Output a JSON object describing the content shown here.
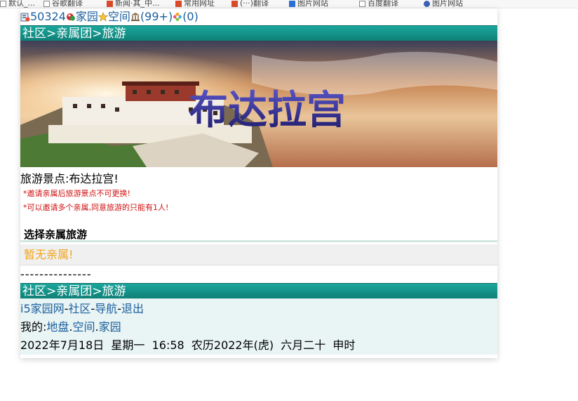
{
  "browser": {
    "bookmarks": [
      "默认_...",
      "谷歌翻译",
      "新闻·其_中...",
      "常用网址",
      "(···)翻译",
      "图片网站",
      "百度翻译",
      "图片网站"
    ]
  },
  "topbar": {
    "user_id": "50324",
    "home_label": "家园",
    "space_label": "空间",
    "count_a": "(99+)",
    "count_b": "(0)"
  },
  "breadcrumb": {
    "community": "社区",
    "sep": ">",
    "relatives": "亲属团",
    "travel": "旅游"
  },
  "banner": {
    "title": "布达拉宫"
  },
  "content": {
    "spot_line": "旅游景点:布达拉宫!",
    "note1": "*邀请亲属后旅游景点不可更换!",
    "note2": "*可以邀请多个亲属,同意旅游的只能有1人!",
    "choose_title": "选择亲属旅游",
    "empty_msg": "暂无亲属!",
    "dashes": "---------------"
  },
  "footer": {
    "site": "i5家园网",
    "dash": "-",
    "community": "社区",
    "nav": "导航",
    "logout": "退出",
    "mine_prefix": "我的:",
    "land": "地盘",
    "dot": ".",
    "space": "空间",
    "home": "家园",
    "datetime": "2022年7月18日  星期一  16:58  农历2022年(虎)  六月二十  申时"
  },
  "colors": {
    "bar": "#0f7f77",
    "link": "#1b5f9e",
    "warning": "#d01010",
    "empty": "#f2a41a"
  }
}
